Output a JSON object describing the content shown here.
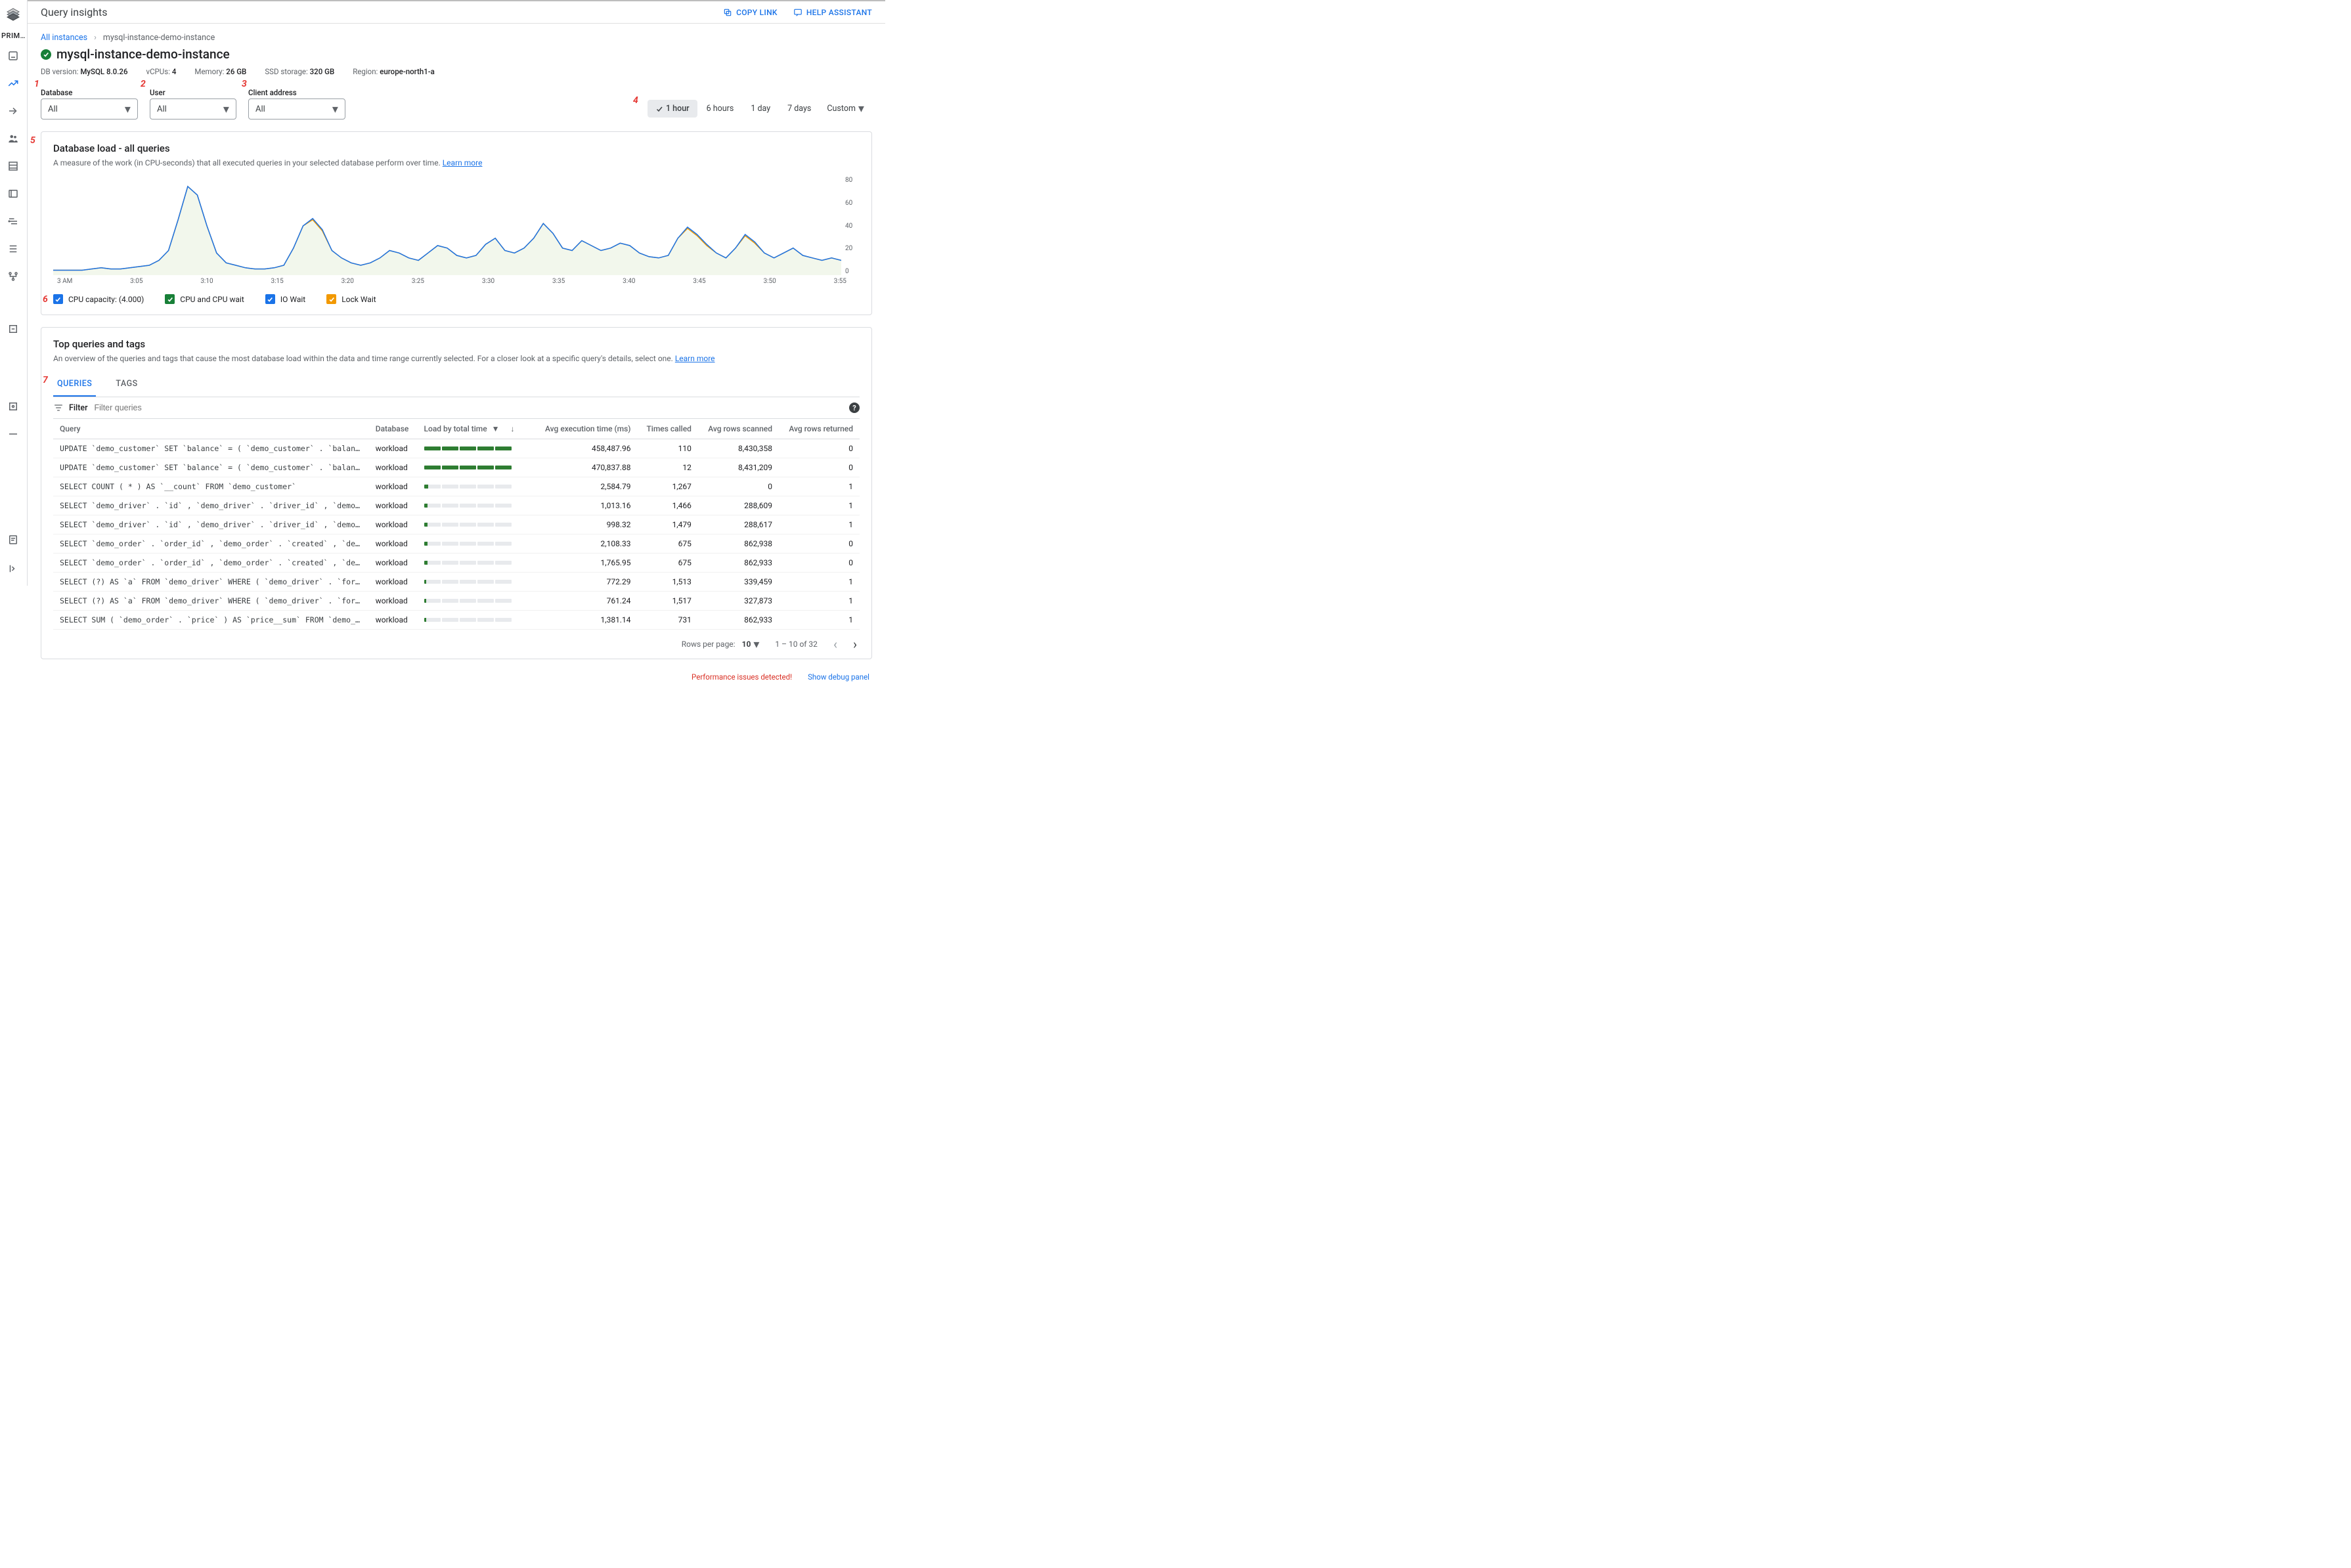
{
  "page": {
    "title": "Query insights",
    "actions": {
      "copy_link": "COPY LINK",
      "help_assistant": "HELP ASSISTANT"
    }
  },
  "sidebar": {
    "project_label": "PRIM…"
  },
  "breadcrumb": {
    "parent": "All instances",
    "current": "mysql-instance-demo-instance"
  },
  "instance": {
    "name": "mysql-instance-demo-instance",
    "db_version_label": "DB version:",
    "db_version": "MySQL 8.0.26",
    "vcpu_label": "vCPUs:",
    "vcpu": "4",
    "memory_label": "Memory:",
    "memory": "26 GB",
    "ssd_label": "SSD storage:",
    "ssd": "320 GB",
    "region_label": "Region:",
    "region": "europe-north1-a"
  },
  "filters": {
    "database": {
      "label": "Database",
      "value": "All"
    },
    "user": {
      "label": "User",
      "value": "All"
    },
    "client": {
      "label": "Client address",
      "value": "All"
    }
  },
  "time_range": {
    "options": [
      "1 hour",
      "6 hours",
      "1 day",
      "7 days"
    ],
    "custom": "Custom",
    "active_index": 0
  },
  "annotations": [
    "1",
    "2",
    "3",
    "4",
    "5",
    "6",
    "7"
  ],
  "load_card": {
    "title": "Database load - all queries",
    "subtitle": "A measure of the work (in CPU-seconds) that all executed queries in your selected database perform over time.",
    "learn_more": "Learn more",
    "legend": [
      {
        "label": "CPU capacity: (4.000)",
        "color": "#1a73e8"
      },
      {
        "label": "CPU and CPU wait",
        "color": "#188038"
      },
      {
        "label": "IO Wait",
        "color": "#1a73e8"
      },
      {
        "label": "Lock Wait",
        "color": "#f29900"
      }
    ]
  },
  "chart_data": {
    "type": "area",
    "x_labels": [
      "3 AM",
      "3:05",
      "3:10",
      "3:15",
      "3:20",
      "3:25",
      "3:30",
      "3:35",
      "3:40",
      "3:45",
      "3:50",
      "3:55"
    ],
    "y_ticks": [
      0,
      20,
      40,
      60,
      80
    ],
    "ylim": [
      0,
      80
    ],
    "cpu_capacity": 4.0,
    "series": [
      {
        "name": "Lock Wait",
        "color": "#f29900",
        "values": [
          4,
          4,
          4,
          4,
          5,
          6,
          5,
          5,
          6,
          7,
          8,
          12,
          20,
          45,
          72,
          65,
          40,
          18,
          10,
          8,
          6,
          5,
          5,
          6,
          8,
          22,
          40,
          45,
          36,
          20,
          14,
          10,
          8,
          10,
          14,
          20,
          18,
          14,
          12,
          18,
          24,
          22,
          16,
          14,
          16,
          25,
          30,
          20,
          18,
          22,
          30,
          42,
          34,
          22,
          20,
          28,
          24,
          20,
          22,
          26,
          24,
          18,
          15,
          14,
          16,
          30,
          38,
          32,
          24,
          18,
          14,
          22,
          32,
          26,
          18,
          14,
          18,
          22,
          16,
          14,
          12,
          14,
          12
        ]
      },
      {
        "name": "IO Wait",
        "color": "#1a73e8",
        "values": [
          4,
          4,
          4,
          4,
          5,
          6,
          5,
          5,
          6,
          7,
          8,
          12,
          20,
          45,
          72,
          65,
          40,
          18,
          10,
          8,
          6,
          5,
          5,
          6,
          8,
          22,
          40,
          46,
          37,
          20,
          14,
          10,
          8,
          10,
          14,
          20,
          18,
          14,
          12,
          18,
          24,
          22,
          16,
          14,
          16,
          25,
          30,
          20,
          18,
          22,
          30,
          42,
          34,
          22,
          20,
          28,
          24,
          20,
          22,
          26,
          24,
          18,
          15,
          14,
          16,
          30,
          39,
          33,
          25,
          18,
          14,
          22,
          33,
          27,
          18,
          14,
          18,
          22,
          16,
          14,
          12,
          14,
          12
        ]
      }
    ]
  },
  "top_card": {
    "title": "Top queries and tags",
    "subtitle": "An overview of the queries and tags that cause the most database load within the data and time range currently selected. For a closer look at a specific query's details, select one.",
    "learn_more": "Learn more",
    "tabs": [
      "QUERIES",
      "TAGS"
    ],
    "active_tab": 0,
    "filter_label": "Filter",
    "filter_placeholder": "Filter queries",
    "columns": [
      "Query",
      "Database",
      "Load by total time",
      "Avg execution time (ms)",
      "Times called",
      "Avg rows scanned",
      "Avg rows returned"
    ],
    "rows": [
      {
        "query": "UPDATE `demo_customer` SET `balance` = ( `demo_customer` . `balance` - ? ) WHERE `demo_customer` . `name…",
        "db": "workload",
        "load": 1.0,
        "exec": "458,487.96",
        "called": "110",
        "scanned": "8,430,358",
        "returned": "0"
      },
      {
        "query": "UPDATE `demo_customer` SET `balance` = ( `demo_customer` . `balance` + ? ) WHERE `demo_customer` . `name…",
        "db": "workload",
        "load": 1.0,
        "exec": "470,837.88",
        "called": "12",
        "scanned": "8,431,209",
        "returned": "0"
      },
      {
        "query": "SELECT COUNT ( * ) AS `__count` FROM `demo_customer`",
        "db": "workload",
        "load": 0.05,
        "exec": "2,584.79",
        "called": "1,267",
        "scanned": "0",
        "returned": "1"
      },
      {
        "query": "SELECT `demo_driver` . `id` , `demo_driver` . `driver_id` , `demo_driver` . `name` , `demo_driver` . `address` , `dem…",
        "db": "workload",
        "load": 0.04,
        "exec": "1,013.16",
        "called": "1,466",
        "scanned": "288,609",
        "returned": "1"
      },
      {
        "query": "SELECT `demo_driver` . `id` , `demo_driver` . `driver_id` , `demo_driver` . `name` , `demo_driver` . `address` , `dem…",
        "db": "workload",
        "load": 0.04,
        "exec": "998.32",
        "called": "1,479",
        "scanned": "288,617",
        "returned": "1"
      },
      {
        "query": "SELECT `demo_order` . `order_id` , `demo_order` . `created` , `demo_order` . `updated` , `demo_order` . `city` , `de…",
        "db": "workload",
        "load": 0.04,
        "exec": "2,108.33",
        "called": "675",
        "scanned": "862,938",
        "returned": "0"
      },
      {
        "query": "SELECT `demo_order` . `order_id` , `demo_order` . `created` , `demo_order` . `updated` , `demo_order` . `city` , `de…",
        "db": "workload",
        "load": 0.04,
        "exec": "1,765.95",
        "called": "675",
        "scanned": "862,933",
        "returned": "0"
      },
      {
        "query": "SELECT (?) AS `a` FROM `demo_driver` WHERE ( `demo_driver` . `for_eats` = ? AND `demo_driver` . `current_order…",
        "db": "workload",
        "load": 0.03,
        "exec": "772.29",
        "called": "1,513",
        "scanned": "339,459",
        "returned": "1"
      },
      {
        "query": "SELECT (?) AS `a` FROM `demo_driver` WHERE ( `demo_driver` . `for_trip` = ? AND `demo_driver` . `current_order…",
        "db": "workload",
        "load": 0.03,
        "exec": "761.24",
        "called": "1,517",
        "scanned": "327,873",
        "returned": "1"
      },
      {
        "query": "SELECT SUM ( `demo_order` . `price` ) AS `price__sum` FROM `demo_order` WHERE ( `demo_order` . `customer_i…",
        "db": "workload",
        "load": 0.03,
        "exec": "1,381.14",
        "called": "731",
        "scanned": "862,933",
        "returned": "1"
      }
    ],
    "pager": {
      "rpp_label": "Rows per page:",
      "rpp_value": "10",
      "range": "1 – 10 of 32"
    }
  },
  "footer": {
    "perf": "Performance issues detected!",
    "debug": "Show debug panel"
  }
}
